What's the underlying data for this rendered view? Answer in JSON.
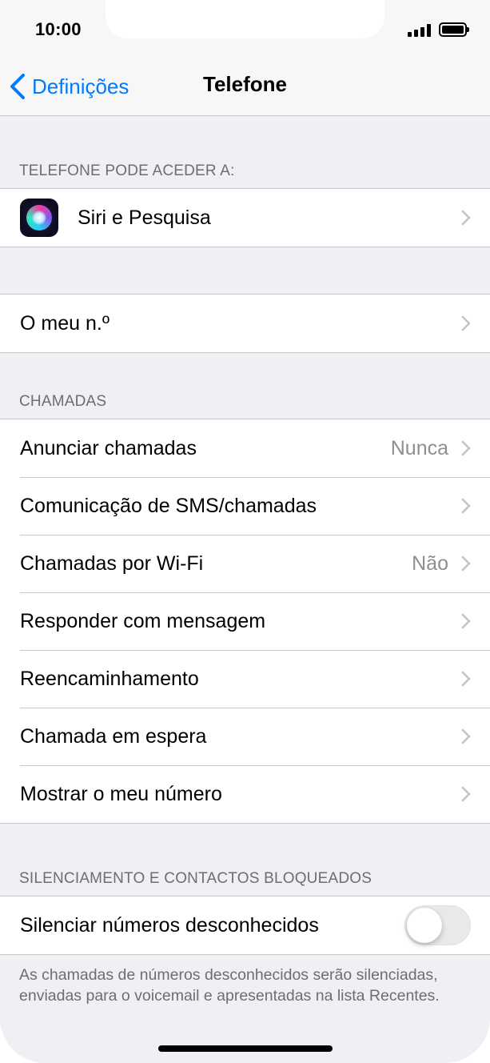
{
  "status_bar": {
    "time": "10:00"
  },
  "nav": {
    "back_label": "Definições",
    "title": "Telefone"
  },
  "sections": {
    "access": {
      "header": "TELEFONE PODE ACEDER A:",
      "siri_label": "Siri e Pesquisa"
    },
    "my_number": {
      "label": "O meu n.º"
    },
    "calls": {
      "header": "CHAMADAS",
      "rows": [
        {
          "label": "Anunciar chamadas",
          "value": "Nunca"
        },
        {
          "label": "Comunicação de SMS/chamadas",
          "value": ""
        },
        {
          "label": "Chamadas por Wi-Fi",
          "value": "Não"
        },
        {
          "label": "Responder com mensagem",
          "value": ""
        },
        {
          "label": "Reencaminhamento",
          "value": ""
        },
        {
          "label": "Chamada em espera",
          "value": ""
        },
        {
          "label": "Mostrar o meu número",
          "value": ""
        }
      ]
    },
    "silencing": {
      "header": "SILENCIAMENTO E CONTACTOS BLOQUEADOS",
      "toggle_label": "Silenciar números desconhecidos",
      "toggle_on": false,
      "footer": "As chamadas de números desconhecidos serão silenciadas, enviadas para o voicemail e apresentadas na lista Recentes."
    }
  },
  "colors": {
    "accent": "#007aff",
    "background": "#efeff4",
    "secondary_text": "#6d6d72"
  }
}
